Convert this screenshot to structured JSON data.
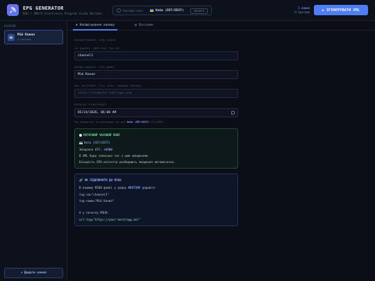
{
  "header": {
    "title": "EPG GENERATOR",
    "subtitle": "M3U / XMLTV Electronic Program Guide Builder",
    "timezone_label": "Часовий пояс",
    "timezone_value": "Київ (EET/EEST)",
    "timezone_change": "ЗМІНИТИ",
    "stats_count": "1 канал",
    "stats_programs": "0 програм",
    "generate_button": "ЗГЕНЕРУВАТИ XML"
  },
  "sidebar": {
    "heading": "КАНАЛИ",
    "channels": [
      {
        "badge": "МК",
        "name": "Мій Канал",
        "count": "0 програм"
      }
    ],
    "add_button": "Додати канал"
  },
  "tabs": [
    {
      "label": "Налаштування каналу",
      "active": true
    },
    {
      "label": "Програми",
      "active": false
    }
  ],
  "form": {
    "section_title": "НАЛАШТУВАННЯ: МІЙ КАНАЛ",
    "id_label": "ID КАНАЛУ (ДЛЯ M3U TVG-ID)",
    "id_value": "channel1",
    "name_label": "НАЗВА КАНАЛУ (TVG-NAME)",
    "name_value": "Мій Канал",
    "logo_label": "URL ЛОГОТИПУ (TVG-LOGO, НЕОБОВ'ЯЗКОВО)",
    "logo_placeholder": "https://example.com/logo.png",
    "start_label": "ПОЧАТОК ТРАНСЛЯЦІЇ",
    "start_value": "05/24/2026, 06:00 AM",
    "hint_prefix": "Час вводиться за локальним час для",
    "hint_tz": "Київ (EET/EEST)",
    "hint_suffix": "UTC+0300"
  },
  "tz_card": {
    "title": "ПОТОЧНИЙ ЧАСОВИЙ ПОЯС",
    "city": "Київ (EET/EEST)",
    "offset_label": "Зміщення UTC:",
    "offset_value": "+0300",
    "line1": "В XML буде записано час з цим зміщенням.",
    "line2": "Більшість EPG-клієнтів розбирають зміщення автоматично."
  },
  "howto_card": {
    "title": "ЯК ПІДКЛЮЧИТИ ДО M3U8",
    "line1_prefix": "В вашому M3U8 файлі у рядку",
    "line1_tag": "#EXTINF",
    "line1_suffix": "додайте:",
    "code1": "tvg-id=\"channel1\"",
    "code2": "tvg-name=\"Мій Канал\"",
    "line2": "А у початку M3U8:",
    "code3": "url-tvg=\"https://your-host/epg.xml\""
  },
  "colors": {
    "accent": "#4f7df3",
    "background": "#0b0e16",
    "green_card": "#0e1a19",
    "blue_card": "#0f1528"
  }
}
